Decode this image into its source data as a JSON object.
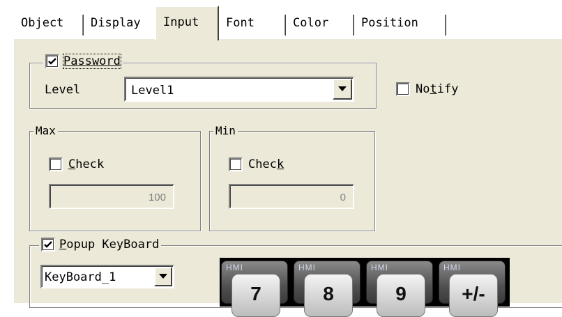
{
  "tabs": [
    {
      "label": "Object",
      "active": false
    },
    {
      "label": "Display",
      "active": false
    },
    {
      "label": "Input",
      "active": true
    },
    {
      "label": "Font",
      "active": false
    },
    {
      "label": "Color",
      "active": false
    },
    {
      "label": "Position",
      "active": false
    }
  ],
  "password": {
    "label": "Password",
    "checked": true,
    "level_label": "Level",
    "level_value": "Level1"
  },
  "notify": {
    "label_pre": "No",
    "label_u": "t",
    "label_post": "ify",
    "checked": false
  },
  "max": {
    "legend": "Max",
    "check_label_u": "C",
    "check_label_rest": "heck",
    "checked": false,
    "value": "100"
  },
  "min": {
    "legend": "Min",
    "check_label_pre": "Chec",
    "check_label_u": "k",
    "checked": false,
    "value": "0"
  },
  "popup": {
    "label_u": "P",
    "label_rest": "opup KeyBoard",
    "checked": true,
    "keyboard_value": "KeyBoard_1"
  },
  "keypad": {
    "watermark": "HMI",
    "keys": [
      "7",
      "8",
      "9",
      "+/-"
    ]
  },
  "colors": {
    "face": "#ece9d8",
    "shadow": "#808080",
    "highlight": "#ffffff"
  }
}
